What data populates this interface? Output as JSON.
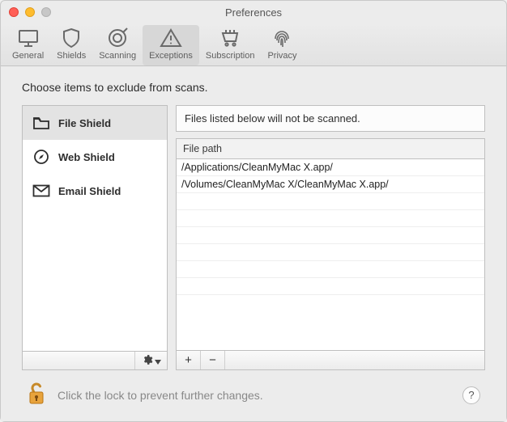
{
  "window": {
    "title": "Preferences"
  },
  "toolbar": {
    "items": [
      {
        "label": "General"
      },
      {
        "label": "Shields"
      },
      {
        "label": "Scanning"
      },
      {
        "label": "Exceptions"
      },
      {
        "label": "Subscription"
      },
      {
        "label": "Privacy"
      }
    ],
    "active_index": 3
  },
  "instruction": "Choose items to exclude from scans.",
  "sidebar": {
    "items": [
      {
        "label": "File Shield"
      },
      {
        "label": "Web Shield"
      },
      {
        "label": "Email Shield"
      }
    ],
    "selected_index": 0
  },
  "main": {
    "info": "Files listed below will not be scanned.",
    "column_header": "File path",
    "rows": [
      "/Applications/CleanMyMac X.app/",
      "/Volumes/CleanMyMac X/CleanMyMac X.app/"
    ],
    "add_label": "+",
    "remove_label": "−"
  },
  "lock": {
    "hint": "Click the lock to prevent further changes.",
    "help_label": "?"
  }
}
